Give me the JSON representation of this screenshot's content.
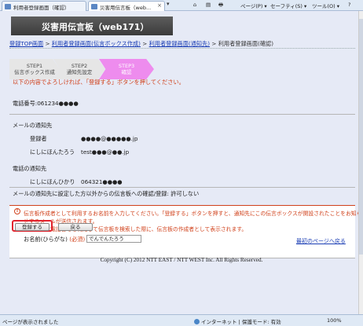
{
  "browser": {
    "tabs": [
      {
        "label": "利用者登録画面（確認）"
      },
      {
        "label": "災害用伝言板（web..."
      }
    ],
    "toolbar": {
      "home": "⌂",
      "feeds": "▤",
      "print": "🖶",
      "page": "ページ(P) ▾",
      "safety": "セーフティ(S) ▾",
      "tools": "ツール(O) ▾",
      "help": "?"
    }
  },
  "header": {
    "title": "災害用伝言板（web171）"
  },
  "breadcrumb": {
    "items": [
      {
        "label": "登録TOP画面"
      },
      {
        "label": "利用者登録画面(伝言ボックス作成)"
      },
      {
        "label": "利用者登録画面(通知先)"
      }
    ],
    "current": "利用者登録画面(確認)",
    "separator": ">"
  },
  "steps": [
    {
      "num": "STEP1",
      "label": "伝言ボックス作成"
    },
    {
      "num": "STEP2",
      "label": "通知先設定"
    },
    {
      "num": "STEP3",
      "label": "確認"
    }
  ],
  "instruction": "以下の内容でよろしければ、「登録する」ボタンを押してください。",
  "phone": {
    "label": "電話番号:",
    "value": "061234●●●●"
  },
  "mail_section": {
    "title": "メールの通知先",
    "rows": [
      {
        "name": "登録者",
        "value": "●●●●@●●●●●.jp"
      },
      {
        "name": "にしにほんたろう",
        "value": "test●●●@●●.jp"
      }
    ]
  },
  "phone_section": {
    "title": "電話の通知先",
    "rows": [
      {
        "name": "にしにほんひかり",
        "value": "064321●●●●"
      }
    ]
  },
  "permission": "メールの通知先に設定した方以外からの伝言板への確認/登録: 許可しない",
  "notice": {
    "line1": "伝言板作成者として利用するお名前を入力してください。「登録する」ボタンを押すと、通知先にこの伝言ボックスが開設されたことをお知ら",
    "line2": "せするメールが送信されます。",
    "line3": "本お名前は電話番号を利用して伝言板を検索した際に、伝言板の作成者として表示されます。"
  },
  "name_field": {
    "label": "お名前(ひらがな)",
    "required": "(必須)",
    "value": "でんでんたろう"
  },
  "buttons": {
    "register": "登録する",
    "back": "戻る"
  },
  "top_link": "最初のページへ戻る",
  "copyright": "Copyright (C) 2012 NTT EAST / NTT WEST Inc. All Rights Reserved.",
  "statusbar": {
    "status": "ページが表示されました",
    "zone": "インターネット | 保護モード: 有効",
    "zoom": "100%"
  },
  "colors": {
    "accent_red": "#e2242e",
    "step_active": "#ee8cee",
    "link": "#1a3db4",
    "warning": "#d0401a"
  }
}
